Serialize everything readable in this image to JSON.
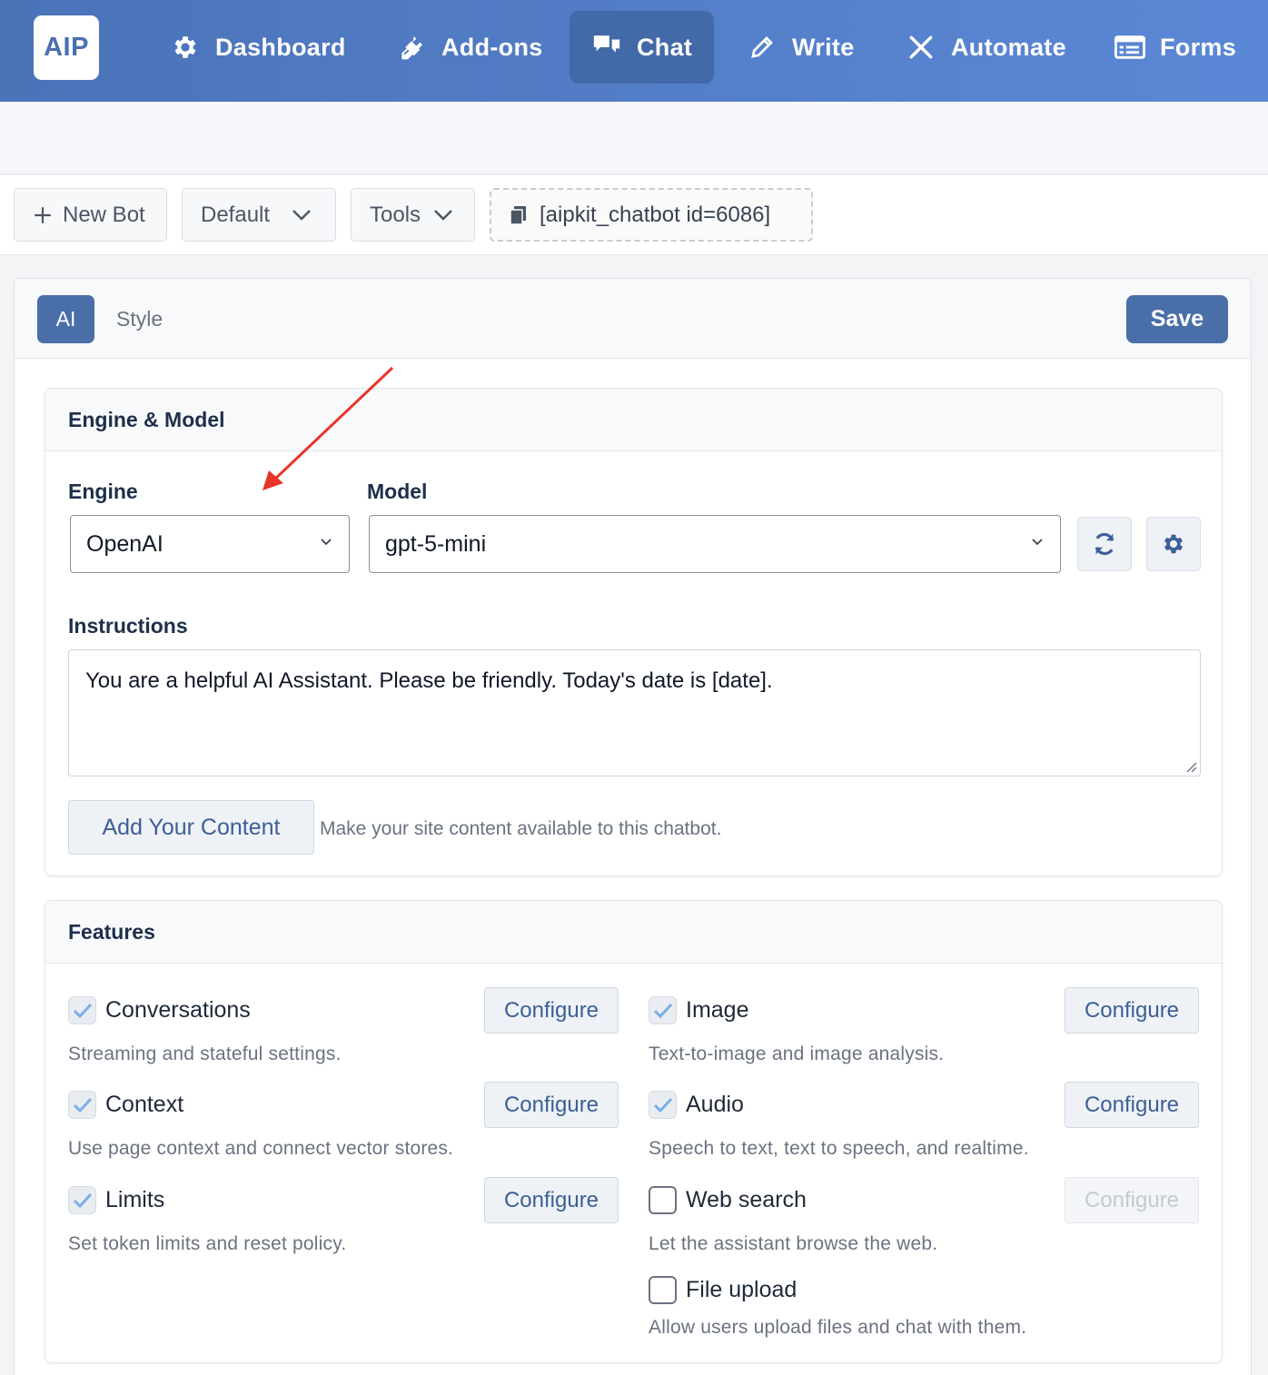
{
  "nav": {
    "logo": "AIP",
    "items": [
      {
        "label": "Dashboard",
        "icon": "gear-icon"
      },
      {
        "label": "Add-ons",
        "icon": "plug-icon"
      },
      {
        "label": "Chat",
        "icon": "chat-bubbles-icon",
        "active": true
      },
      {
        "label": "Write",
        "icon": "pencil-icon"
      },
      {
        "label": "Automate",
        "icon": "tools-cross-icon"
      },
      {
        "label": "Forms",
        "icon": "form-icon"
      }
    ],
    "colors": {
      "from": "#4a73b8",
      "to": "#5b88d6",
      "active": "#4269a8"
    }
  },
  "toolbar": {
    "new_bot": "New Bot",
    "default": "Default",
    "tools": "Tools",
    "shortcode": "[aipkit_chatbot id=6086]"
  },
  "tabs": {
    "ai": "AI",
    "style": "Style",
    "save": "Save"
  },
  "engine_model": {
    "title": "Engine & Model",
    "engine_label": "Engine",
    "engine_value": "OpenAI",
    "model_label": "Model",
    "model_value": "gpt-5-mini",
    "instructions_label": "Instructions",
    "instructions_value": "You are a helpful AI Assistant. Please be friendly. Today's date is [date].",
    "add_content_button": "Add Your Content",
    "add_content_hint": "Make your site content available to this chatbot."
  },
  "features": {
    "title": "Features",
    "configure_label": "Configure",
    "items": [
      {
        "label": "Conversations",
        "desc": "Streaming and stateful settings.",
        "checked": true
      },
      {
        "label": "Image",
        "desc": "Text-to-image and image analysis.",
        "checked": true
      },
      {
        "label": "Context",
        "desc": "Use page context and connect vector stores.",
        "checked": true
      },
      {
        "label": "Audio",
        "desc": "Speech to text, text to speech, and realtime.",
        "checked": true
      },
      {
        "label": "Limits",
        "desc": "Set token limits and reset policy.",
        "checked": true
      },
      {
        "label": "Web search",
        "desc": "Let the assistant browse the web.",
        "checked": false
      },
      {
        "label": "File upload",
        "desc": "Allow users upload files and chat with them.",
        "checked": false
      }
    ]
  },
  "accent_color": "#4a6fa8",
  "annotation_arrow_color": "#e8352a"
}
